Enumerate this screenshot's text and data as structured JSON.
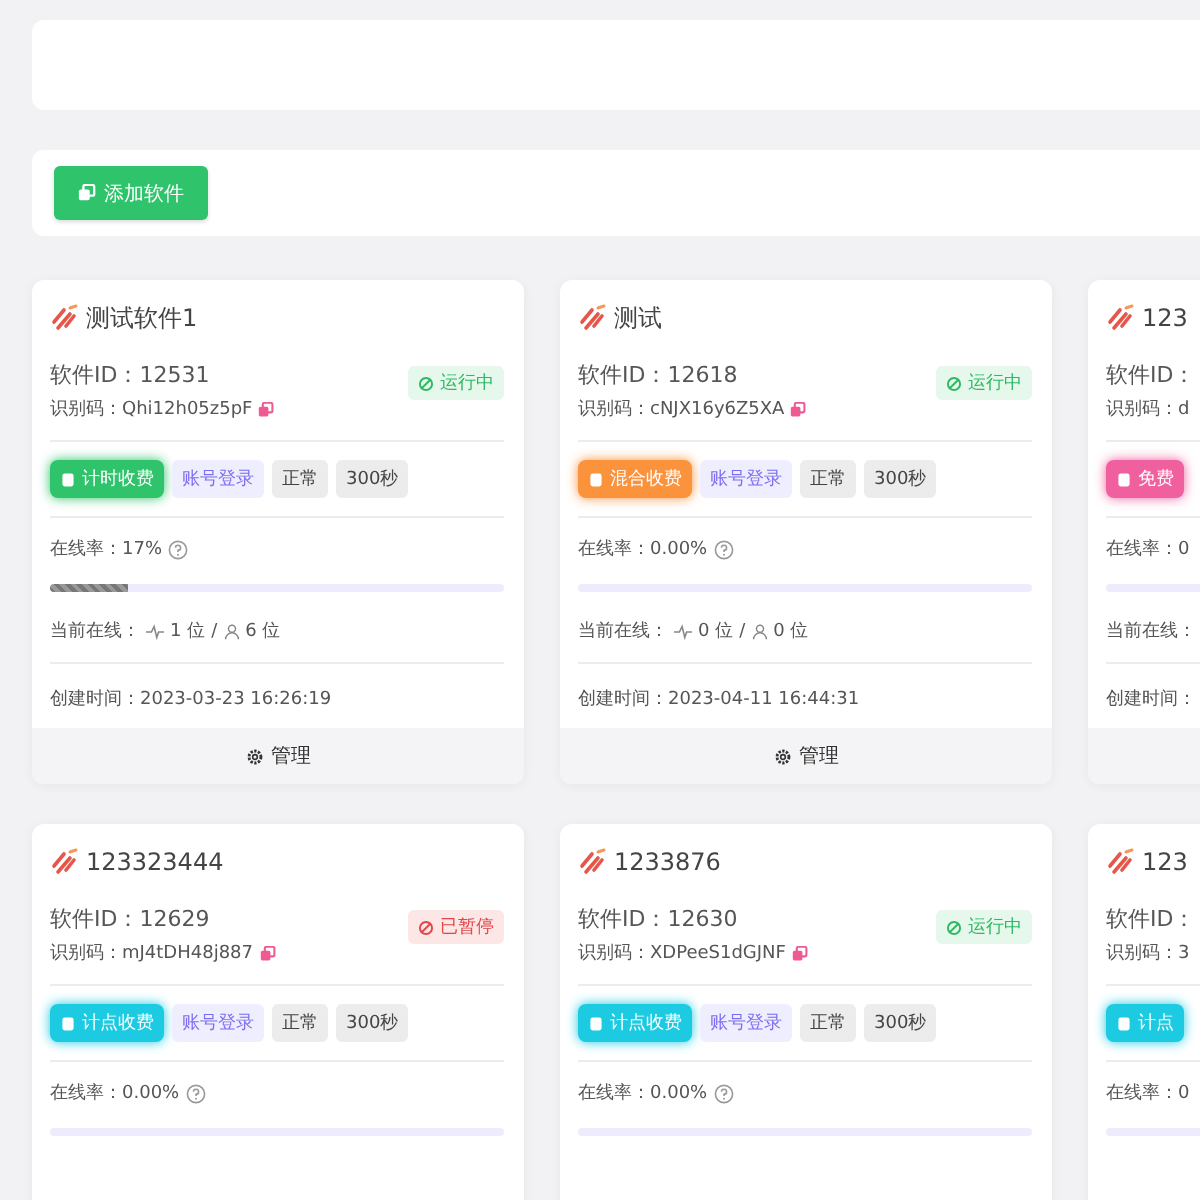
{
  "toolbar": {
    "add_button": "添加软件"
  },
  "cards": [
    {
      "title": "测试软件1",
      "software_id": "软件ID：12531",
      "code": "识别码：Qhi12h05z5pF",
      "status": {
        "label": "运行中",
        "kind": "running"
      },
      "billing": {
        "label": "计时收费",
        "kind": "timed"
      },
      "login": "账号登录",
      "mode": "正常",
      "interval": "300秒",
      "rate": "在线率：17%",
      "level": 0.17,
      "online_label": "当前在线：",
      "online": "1 位",
      "separator": "/",
      "total": "6 位",
      "created": "创建时间：2023-03-23 16:26:19",
      "manage": "管理"
    },
    {
      "title": "测试",
      "software_id": "软件ID：12618",
      "code": "识别码：cNJX16y6Z5XA",
      "status": {
        "label": "运行中",
        "kind": "running"
      },
      "billing": {
        "label": "混合收费",
        "kind": "mixed"
      },
      "login": "账号登录",
      "mode": "正常",
      "interval": "300秒",
      "rate": "在线率：0.00%",
      "online_label": "当前在线：",
      "online": "0 位",
      "separator": "/",
      "total": "0 位",
      "created": "创建时间：2023-04-11 16:44:31",
      "manage": "管理"
    },
    {
      "title": "123",
      "software_id": "软件ID：",
      "code": "识别码：d",
      "billing": {
        "label": "免费",
        "kind": "free"
      },
      "rate": "在线率：0",
      "online_label": "当前在线：",
      "created": "创建时间："
    },
    {
      "title": "123323444",
      "software_id": "软件ID：12629",
      "code": "识别码：mJ4tDH48j887",
      "status": {
        "label": "已暂停",
        "kind": "paused"
      },
      "billing": {
        "label": "计点收费",
        "kind": "points"
      },
      "login": "账号登录",
      "mode": "正常",
      "interval": "300秒",
      "rate": "在线率：0.00%"
    },
    {
      "title": "1233876",
      "software_id": "软件ID：12630",
      "code": "识别码：XDPeeS1dGJNF",
      "status": {
        "label": "运行中",
        "kind": "running"
      },
      "billing": {
        "label": "计点收费",
        "kind": "points"
      },
      "login": "账号登录",
      "mode": "正常",
      "interval": "300秒",
      "rate": "在线率：0.00%"
    },
    {
      "title": "123",
      "software_id": "软件ID：",
      "code": "识别码：3",
      "billing": {
        "label": "计点",
        "kind": "points"
      },
      "rate": "在线率：0"
    }
  ]
}
